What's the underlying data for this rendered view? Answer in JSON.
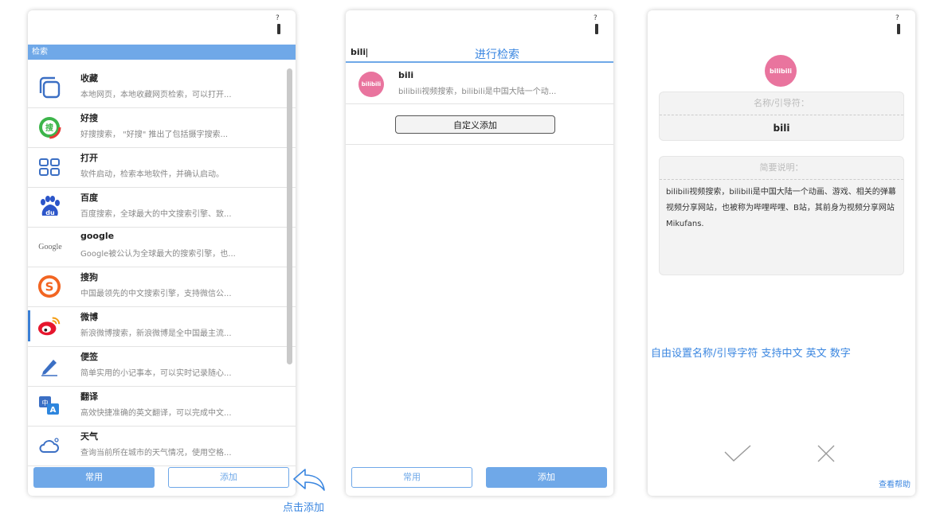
{
  "panel1": {
    "section_label": "检索",
    "items": [
      {
        "title": "收藏",
        "desc": "本地网页，本地收藏网页检索，可以打开...",
        "icon": "bookmark-icon"
      },
      {
        "title": "好搜",
        "desc": "好搜搜索， \"好搜\" 推出了包括摄字搜索...",
        "icon": "haosou-icon"
      },
      {
        "title": "打开",
        "desc": "软件启动，检索本地软件，并确认启动。",
        "icon": "grid-icon"
      },
      {
        "title": "百度",
        "desc": "百度搜索，全球最大的中文搜索引擎、致...",
        "icon": "baidu-paw-icon"
      },
      {
        "title": "google",
        "desc": "Google被公认为全球最大的搜索引擎，也...",
        "icon": "google-logo-icon"
      },
      {
        "title": "搜狗",
        "desc": "中国最领先的中文搜索引擎，支持微信公...",
        "icon": "sogou-icon"
      },
      {
        "title": "微博",
        "desc": "新浪微博搜索，新浪微博是全中国最主流...",
        "icon": "weibo-icon"
      },
      {
        "title": "便签",
        "desc": "简单实用的小记事本，可以实时记录随心...",
        "icon": "pen-icon"
      },
      {
        "title": "翻译",
        "desc": "高效快捷准确的英文翻译，可以完成中文...",
        "icon": "translate-icon"
      },
      {
        "title": "天气",
        "desc": "查询当前所在城市的天气情况，使用空格...",
        "icon": "cloud-icon"
      }
    ],
    "common_button": "常用",
    "add_button": "添加",
    "google_logo_text": "Google"
  },
  "panel2": {
    "search_value": "bili",
    "search_hint": "进行检索",
    "result": {
      "title": "bili",
      "desc": "bilibili视频搜索，bilibili是中国大陆一个动..."
    },
    "custom_add_button": "自定义添加",
    "common_button": "常用",
    "add_button": "添加"
  },
  "panel3": {
    "name_label": "名称/引导符：",
    "name_value": "bili",
    "desc_label": "简要说明：",
    "desc_value": "bilibili视频搜索，bilibili是中国大陆一个动画、游戏、相关的弹幕视频分享网站，也被称为哔哩哔哩、B站，其前身为视频分享网站Mikufans.",
    "feature_text": "自由设置名称/引导字符 支持中文 英文 数字",
    "help_link": "查看帮助"
  },
  "annotation": {
    "text": "点击添加"
  },
  "bili_logo_text": "bilibili",
  "help_mark_text": "?",
  "colors": {
    "accent": "#6fa8e8",
    "link": "#3a86e0",
    "bili_pink": "#e9749e"
  }
}
